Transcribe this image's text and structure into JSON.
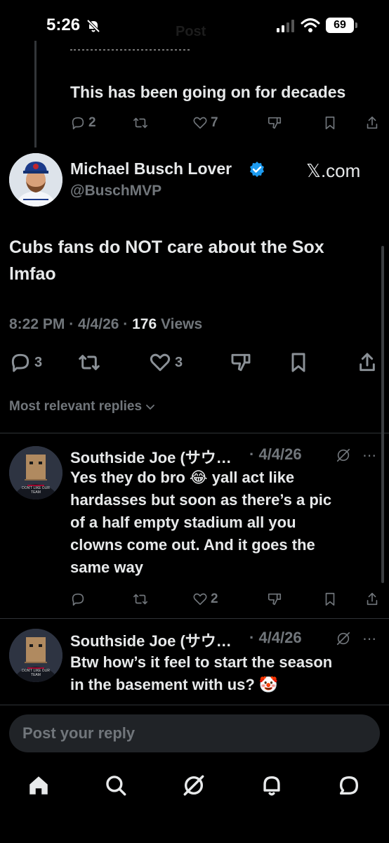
{
  "status_bar": {
    "time": "5:26",
    "battery": "69"
  },
  "faded_header": "Post",
  "prev_post": {
    "text": "This has been going on for decades",
    "replies": "2",
    "likes": "7"
  },
  "main_post": {
    "author_name": "Michael Busch Lover",
    "handle": "@BuschMVP",
    "xcom": "𝕏.com",
    "text_line1": "Cubs fans do NOT care about the Sox",
    "text_line2": "lmfao",
    "time": "8:22 PM",
    "date": "4/4/26",
    "views_count": "176",
    "views_label": "Views",
    "replies": "3",
    "likes": "3"
  },
  "replies_filter": "Most relevant replies",
  "replies": [
    {
      "author": "Southside Joe (サウ…",
      "date": "4/4/26",
      "lines": [
        "Yes they do bro 😂 yall act like",
        "hardasses but soon as there’s a pic",
        "of a half empty stadium all you",
        "clowns come out. And it goes the",
        "same way"
      ],
      "likes": "2",
      "avatar_caption": "DON'T LIKE OUR TEAM"
    },
    {
      "author": "Southside Joe (サウ…",
      "date": "4/4/26",
      "lines": [
        "Btw how’s it feel to start the season",
        "in the basement with us? 🤡"
      ],
      "avatar_caption": "DON'T LIKE OUR TEAM"
    }
  ],
  "reply_box": {
    "placeholder": "Post your reply"
  },
  "nav": [
    "home-icon",
    "search-icon",
    "grok-icon",
    "notifications-icon",
    "messages-icon"
  ]
}
